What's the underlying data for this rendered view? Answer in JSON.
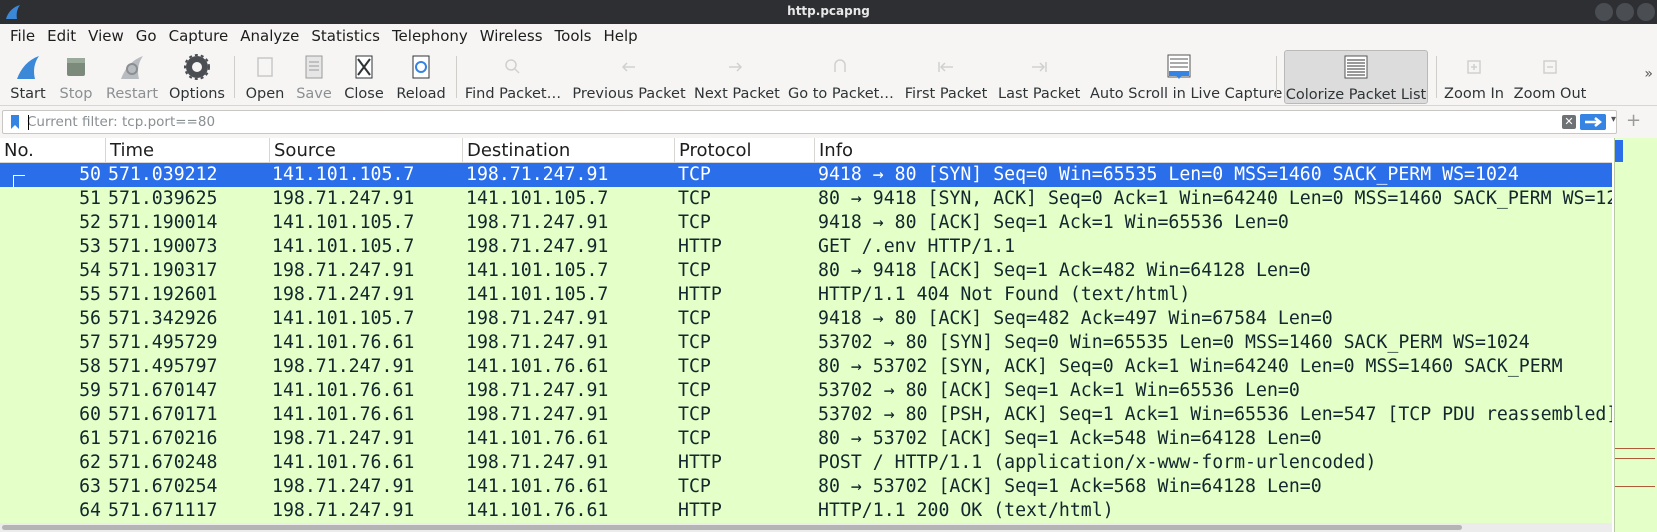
{
  "window": {
    "title": "http.pcapng"
  },
  "menu": [
    "File",
    "Edit",
    "View",
    "Go",
    "Capture",
    "Analyze",
    "Statistics",
    "Telephony",
    "Wireless",
    "Tools",
    "Help"
  ],
  "toolbar": {
    "start": "Start",
    "stop": "Stop",
    "restart": "Restart",
    "options": "Options",
    "open": "Open",
    "save": "Save",
    "close": "Close",
    "reload": "Reload",
    "find_packet": "Find Packet…",
    "previous_packet": "Previous Packet",
    "next_packet": "Next Packet",
    "go_to_packet": "Go to Packet…",
    "first_packet": "First Packet",
    "last_packet": "Last Packet",
    "auto_scroll": "Auto Scroll in Live Capture",
    "colorize": "Colorize Packet List",
    "zoom_in": "Zoom In",
    "zoom_out": "Zoom Out"
  },
  "filter": {
    "value": "",
    "placeholder": "Current filter: tcp.port==80"
  },
  "columns": [
    "No.",
    "Time",
    "Source",
    "Destination",
    "Protocol",
    "Info"
  ],
  "packets": [
    {
      "no": "50",
      "time": "571.039212",
      "src": "141.101.105.7",
      "dst": "198.71.247.91",
      "proto": "TCP",
      "info": "9418 → 80 [SYN] Seq=0 Win=65535 Len=0 MSS=1460 SACK_PERM WS=1024"
    },
    {
      "no": "51",
      "time": "571.039625",
      "src": "198.71.247.91",
      "dst": "141.101.105.7",
      "proto": "TCP",
      "info": "80 → 9418 [SYN, ACK] Seq=0 Ack=1 Win=64240 Len=0 MSS=1460 SACK_PERM WS=128"
    },
    {
      "no": "52",
      "time": "571.190014",
      "src": "141.101.105.7",
      "dst": "198.71.247.91",
      "proto": "TCP",
      "info": "9418 → 80 [ACK] Seq=1 Ack=1 Win=65536 Len=0"
    },
    {
      "no": "53",
      "time": "571.190073",
      "src": "141.101.105.7",
      "dst": "198.71.247.91",
      "proto": "HTTP",
      "info": "GET /.env HTTP/1.1"
    },
    {
      "no": "54",
      "time": "571.190317",
      "src": "198.71.247.91",
      "dst": "141.101.105.7",
      "proto": "TCP",
      "info": "80 → 9418 [ACK] Seq=1 Ack=482 Win=64128 Len=0"
    },
    {
      "no": "55",
      "time": "571.192601",
      "src": "198.71.247.91",
      "dst": "141.101.105.7",
      "proto": "HTTP",
      "info": "HTTP/1.1 404 Not Found  (text/html)"
    },
    {
      "no": "56",
      "time": "571.342926",
      "src": "141.101.105.7",
      "dst": "198.71.247.91",
      "proto": "TCP",
      "info": "9418 → 80 [ACK] Seq=482 Ack=497 Win=67584 Len=0"
    },
    {
      "no": "57",
      "time": "571.495729",
      "src": "141.101.76.61",
      "dst": "198.71.247.91",
      "proto": "TCP",
      "info": "53702 → 80 [SYN] Seq=0 Win=65535 Len=0 MSS=1460 SACK_PERM WS=1024"
    },
    {
      "no": "58",
      "time": "571.495797",
      "src": "198.71.247.91",
      "dst": "141.101.76.61",
      "proto": "TCP",
      "info": "80 → 53702 [SYN, ACK] Seq=0 Ack=1 Win=64240 Len=0 MSS=1460 SACK_PERM"
    },
    {
      "no": "59",
      "time": "571.670147",
      "src": "141.101.76.61",
      "dst": "198.71.247.91",
      "proto": "TCP",
      "info": "53702 → 80 [ACK] Seq=1 Ack=1 Win=65536 Len=0"
    },
    {
      "no": "60",
      "time": "571.670171",
      "src": "141.101.76.61",
      "dst": "198.71.247.91",
      "proto": "TCP",
      "info": "53702 → 80 [PSH, ACK] Seq=1 Ack=1 Win=65536 Len=547 [TCP PDU reassembled]"
    },
    {
      "no": "61",
      "time": "571.670216",
      "src": "198.71.247.91",
      "dst": "141.101.76.61",
      "proto": "TCP",
      "info": "80 → 53702 [ACK] Seq=1 Ack=548 Win=64128 Len=0"
    },
    {
      "no": "62",
      "time": "571.670248",
      "src": "141.101.76.61",
      "dst": "198.71.247.91",
      "proto": "HTTP",
      "info": "POST / HTTP/1.1  (application/x-www-form-urlencoded)"
    },
    {
      "no": "63",
      "time": "571.670254",
      "src": "198.71.247.91",
      "dst": "141.101.76.61",
      "proto": "TCP",
      "info": "80 → 53702 [ACK] Seq=1 Ack=568 Win=64128 Len=0"
    },
    {
      "no": "64",
      "time": "571.671117",
      "src": "198.71.247.91",
      "dst": "141.101.76.61",
      "proto": "HTTP",
      "info": "HTTP/1.1 200 OK  (text/html)"
    }
  ],
  "colors": {
    "selected_row": "#2a6ee9",
    "row_bg": "#e4ffc7",
    "titlebar": "#2d2f33"
  }
}
